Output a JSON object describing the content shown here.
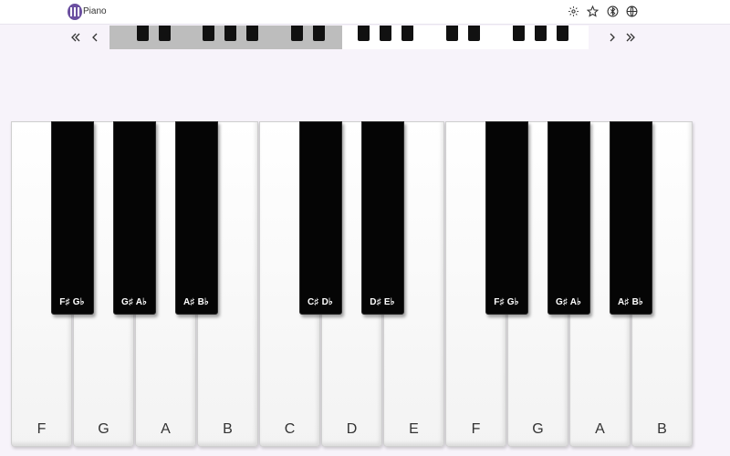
{
  "app": {
    "title": "Piano",
    "icon": "piano-icon"
  },
  "header_actions": [
    {
      "name": "settings-icon",
      "label": "Settings"
    },
    {
      "name": "star-icon",
      "label": "Favorite"
    },
    {
      "name": "bluetooth-icon",
      "label": "Bluetooth"
    },
    {
      "name": "globe-icon",
      "label": "Language"
    }
  ],
  "navigator": {
    "controls": [
      "double-chevron-left-icon",
      "chevron-left-icon",
      "chevron-right-icon",
      "double-chevron-right-icon"
    ]
  },
  "keyboard": {
    "white_keys": [
      "F",
      "G",
      "A",
      "B",
      "C",
      "D",
      "E",
      "F",
      "G",
      "A",
      "B"
    ],
    "black_keys": [
      {
        "label": "F♯ G♭",
        "after_white_index": 0
      },
      {
        "label": "G♯ A♭",
        "after_white_index": 1
      },
      {
        "label": "A♯ B♭",
        "after_white_index": 2
      },
      {
        "label": "C♯ D♭",
        "after_white_index": 4
      },
      {
        "label": "D♯ E♭",
        "after_white_index": 5
      },
      {
        "label": "F♯ G♭",
        "after_white_index": 7
      },
      {
        "label": "G♯ A♭",
        "after_white_index": 8
      },
      {
        "label": "A♯ B♭",
        "after_white_index": 9
      }
    ]
  },
  "colors": {
    "accent": "#6b4fa0",
    "background": "#f7f3fa",
    "black_key": "#050505",
    "white_key": "#ffffff"
  }
}
